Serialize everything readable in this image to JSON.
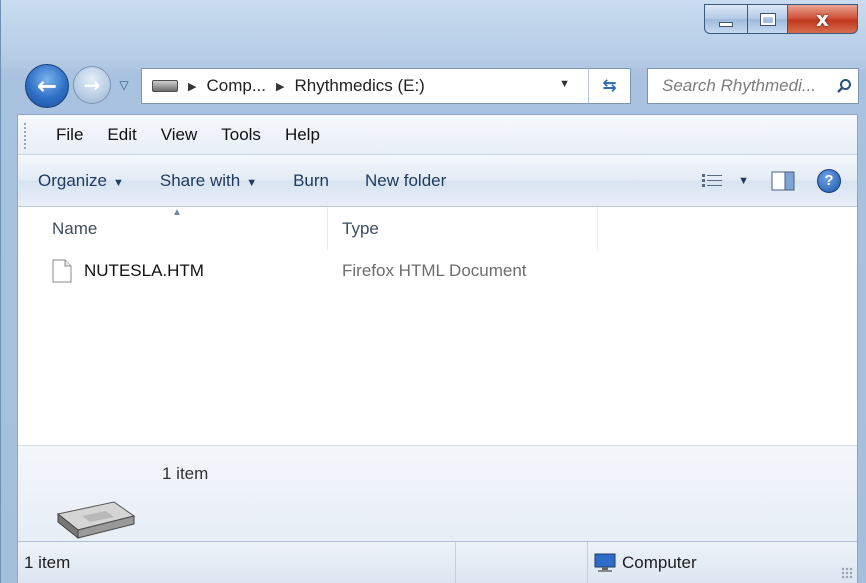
{
  "window": {
    "caption": {
      "minimize": "",
      "maximize": "",
      "close": "x"
    }
  },
  "navigation": {
    "breadcrumb": [
      "Comp...",
      "Rhythmedics (E:)"
    ],
    "search_placeholder": "Search Rhythmedi..."
  },
  "menu": [
    "File",
    "Edit",
    "View",
    "Tools",
    "Help"
  ],
  "toolbar": {
    "organize": "Organize",
    "share_with": "Share with",
    "burn": "Burn",
    "new_folder": "New folder"
  },
  "columns": {
    "name": "Name",
    "type": "Type"
  },
  "files": [
    {
      "name": "NUTESLA.HTM",
      "type": "Firefox HTML Document"
    }
  ],
  "details": {
    "count": "1 item"
  },
  "status": {
    "left": "1 item",
    "location": "Computer"
  },
  "icons": {
    "back": "back-arrow-icon",
    "forward": "forward-arrow-icon",
    "search": "search-icon",
    "help": "help-icon",
    "drive": "drive-icon",
    "document": "document-icon",
    "computer": "computer-icon"
  },
  "colors": {
    "frame": "#a4bedc",
    "close_button": "#c1391f",
    "toolbar_text": "#1e3a5f",
    "type_text": "#6d6d6d"
  }
}
